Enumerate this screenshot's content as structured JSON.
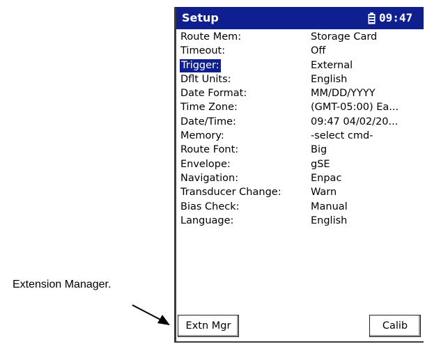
{
  "callout": {
    "text": "Extension Manager."
  },
  "device": {
    "title": "Setup",
    "time": "09:47",
    "icons": {
      "battery": "battery-icon"
    },
    "colors": {
      "titlebar": "#0f1f8f",
      "selection": "#0f1f8f"
    },
    "settings": [
      {
        "label": "Route Mem:",
        "value": "Storage Card"
      },
      {
        "label": "Timeout:",
        "value": "Off"
      },
      {
        "label": "Trigger:",
        "value": "External",
        "selected": true
      },
      {
        "label": "Dflt Units:",
        "value": "English"
      },
      {
        "label": "Date Format:",
        "value": "MM/DD/YYYY"
      },
      {
        "label": "Time Zone:",
        "value": "(GMT-05:00) Ea..."
      },
      {
        "label": "Date/Time:",
        "value": "09:47 04/02/20..."
      },
      {
        "label": "Memory:",
        "value": "-select cmd-"
      },
      {
        "label": "Route Font:",
        "value": "Big"
      },
      {
        "label": "Envelope:",
        "value": "gSE"
      },
      {
        "label": "Navigation:",
        "value": "Enpac"
      },
      {
        "label": "Transducer Change:",
        "value": "Warn"
      },
      {
        "label": "Bias Check:",
        "value": "Manual"
      },
      {
        "label": "Language:",
        "value": "English"
      }
    ],
    "buttons": {
      "extn_mgr": "Extn Mgr",
      "calib": "Calib"
    }
  }
}
